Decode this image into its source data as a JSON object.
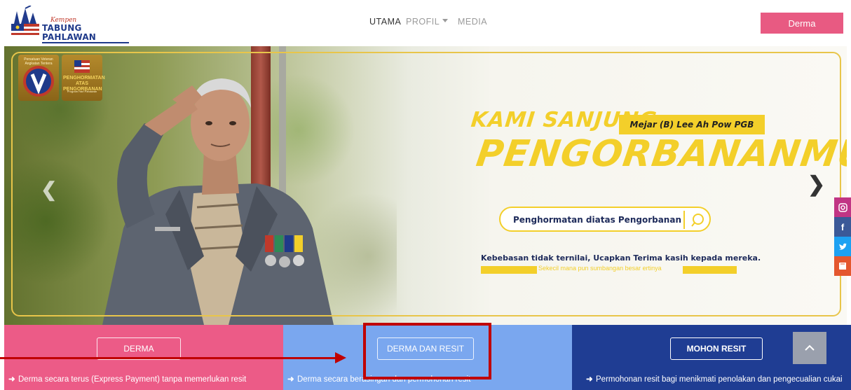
{
  "logo": {
    "kempen": "Kempen",
    "name": "TABUNG PAHLAWAN"
  },
  "nav": {
    "items": [
      {
        "label": "UTAMA"
      },
      {
        "label": "PROFIL"
      },
      {
        "label": "MEDIA"
      }
    ],
    "donate_label": "Derma"
  },
  "hero": {
    "badge1_text": "Persatuan Veteran Angkatan Tentera",
    "badge2_title": "PENGHORMATAN ATAS PENGORBANAN",
    "badge2_sub": "Program Hari Pahlawan",
    "headline_small": "KAMI SANJUNG",
    "tag": "Mejar (B) Lee Ah Pow PGB",
    "headline_big": "PENGORBANANMU",
    "search_text": "Penghormatan diatas Pengorbanan",
    "line1": "Kebebasan tidak ternilai, Ucapkan Terima kasih kepada mereka.",
    "line2": "Sekecil mana pun sumbangan besar ertinya"
  },
  "panels": [
    {
      "button": "DERMA",
      "desc": "Derma secara terus (Express Payment) tanpa memerlukan resit",
      "color": "#ec5b87"
    },
    {
      "button": "DERMA DAN RESIT",
      "desc": "Derma secara berasingan dan permohonan resit",
      "color": "#7aa7ef"
    },
    {
      "button": "MOHON RESIT",
      "desc": "Permohonan resit bagi menikmati penolakan dan pengecualian cukai",
      "color": "#1f3d93"
    }
  ],
  "social": [
    "instagram-icon",
    "facebook-icon",
    "twitter-icon",
    "book-icon"
  ],
  "colors": {
    "accent_pink": "#e85a82",
    "gold": "#f3cf2a",
    "navy": "#1f3d93",
    "annotation": "#c00000"
  }
}
